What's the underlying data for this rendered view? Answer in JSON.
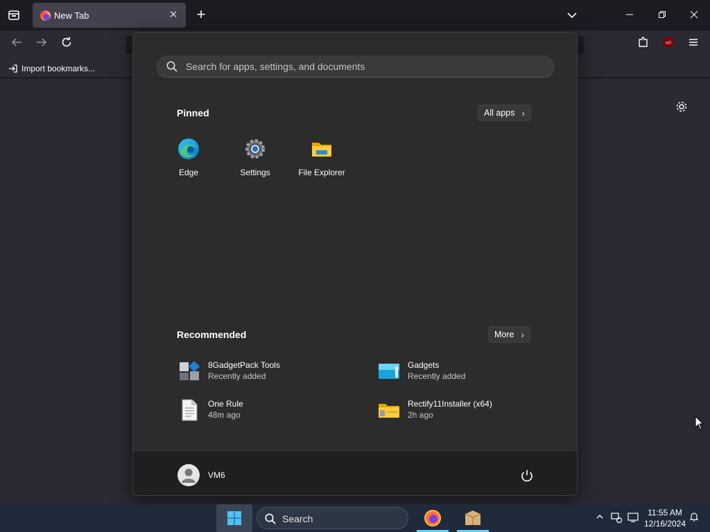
{
  "browser": {
    "tab": {
      "title": "New Tab"
    },
    "bookmarks": {
      "import_label": "Import bookmarks..."
    }
  },
  "start_menu": {
    "search_placeholder": "Search for apps, settings, and documents",
    "pinned": {
      "title": "Pinned",
      "all_apps_label": "All apps",
      "apps": [
        {
          "label": "Edge",
          "icon": "edge-icon"
        },
        {
          "label": "Settings",
          "icon": "settings-gear-icon"
        },
        {
          "label": "File Explorer",
          "icon": "folder-icon"
        }
      ]
    },
    "recommended": {
      "title": "Recommended",
      "more_label": "More",
      "items": [
        {
          "name": "8GadgetPack Tools",
          "detail": "Recently added",
          "icon": "gadgetpack-icon"
        },
        {
          "name": "Gadgets",
          "detail": "Recently added",
          "icon": "gadgets-icon"
        },
        {
          "name": "One Rule",
          "detail": "48m ago",
          "icon": "document-icon"
        },
        {
          "name": "Rectify11Installer (x64)",
          "detail": "2h ago",
          "icon": "zip-folder-icon"
        }
      ]
    },
    "user": {
      "name": "VM6"
    }
  },
  "taskbar": {
    "search_placeholder": "Search",
    "clock": {
      "time": "11:55 AM",
      "date": "12/16/2024"
    }
  },
  "colors": {
    "start_bg": "#2c2c2c",
    "taskbar_bg": "#1f2a3a",
    "accent": "#60cdff",
    "browser_bg": "#2b2a33"
  }
}
